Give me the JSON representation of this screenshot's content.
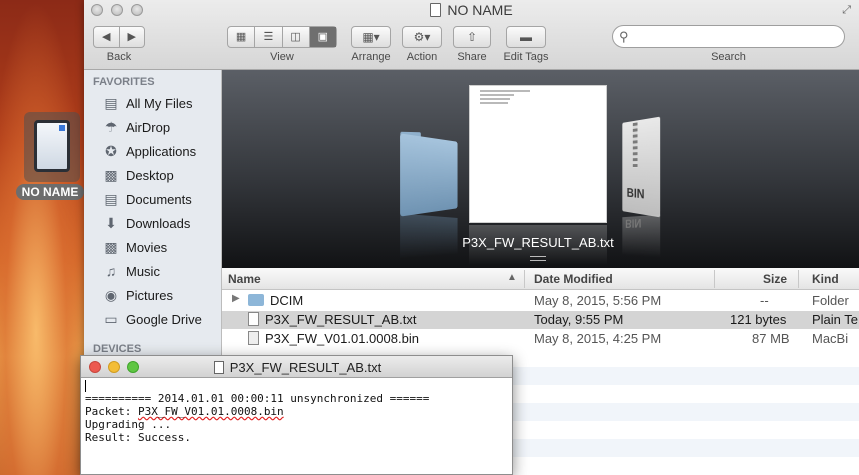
{
  "desktop": {
    "drive_label": "NO NAME"
  },
  "finder": {
    "title": "NO NAME",
    "toolbar": {
      "back_label": "Back",
      "view_label": "View",
      "arrange_label": "Arrange",
      "action_label": "Action",
      "share_label": "Share",
      "edit_tags_label": "Edit Tags",
      "search_label": "Search",
      "search_placeholder": ""
    },
    "sidebar": {
      "favorites_heading": "FAVORITES",
      "items": [
        {
          "label": "All My Files",
          "icon": "all-files-icon"
        },
        {
          "label": "AirDrop",
          "icon": "airdrop-icon"
        },
        {
          "label": "Applications",
          "icon": "applications-icon"
        },
        {
          "label": "Desktop",
          "icon": "desktop-icon"
        },
        {
          "label": "Documents",
          "icon": "documents-icon"
        },
        {
          "label": "Downloads",
          "icon": "downloads-icon"
        },
        {
          "label": "Movies",
          "icon": "movies-icon"
        },
        {
          "label": "Music",
          "icon": "music-icon"
        },
        {
          "label": "Pictures",
          "icon": "pictures-icon"
        },
        {
          "label": "Google Drive",
          "icon": "folder-icon"
        }
      ],
      "devices_heading": "DEVICES"
    },
    "coverflow": {
      "caption": "P3X_FW_RESULT_AB.txt",
      "bin_label": "BIN"
    },
    "columns": {
      "name": "Name",
      "date": "Date Modified",
      "size": "Size",
      "kind": "Kind"
    },
    "files": [
      {
        "name": "DCIM",
        "date": "May 8, 2015, 5:56 PM",
        "size": "--",
        "kind": "Folder",
        "type": "folder"
      },
      {
        "name": "P3X_FW_RESULT_AB.txt",
        "date": "Today, 9:55 PM",
        "size": "121 bytes",
        "kind": "Plain Te",
        "type": "text"
      },
      {
        "name": "P3X_FW_V01.01.0008.bin",
        "date": "May 8, 2015, 4:25 PM",
        "size": "87 MB",
        "kind": "MacBi",
        "type": "bin"
      }
    ]
  },
  "textedit": {
    "title": "P3X_FW_RESULT_AB.txt",
    "lines": {
      "l1": "========== 2014.01.01 00:00:11 unsynchronized ======",
      "l2_prefix": "Packet: ",
      "l2_file": "P3X_FW_V01.01.0008.bin",
      "l3": "Upgrading ...",
      "l4": "Result: Success."
    }
  },
  "colors": {
    "selection_row": "#d4d4d4",
    "stripe": "#f1f5fa",
    "sidebar_bg": "#e6eaef"
  }
}
